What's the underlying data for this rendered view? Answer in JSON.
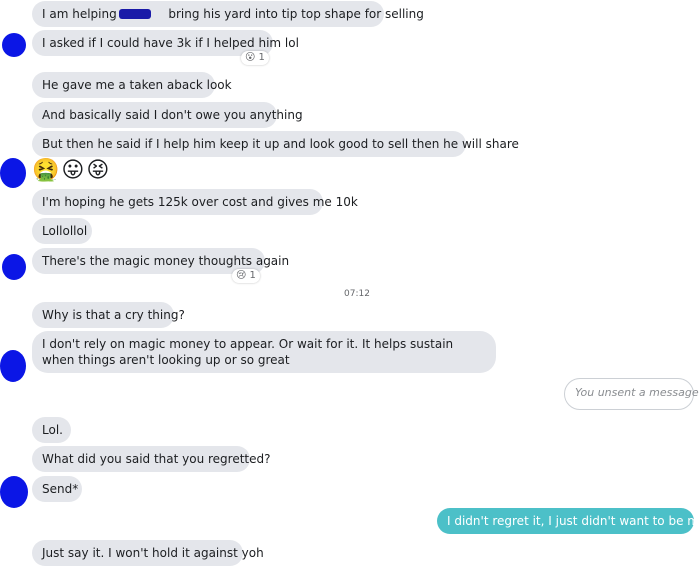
{
  "colors": {
    "incoming_bubble": "#e4e6eb",
    "outgoing_bubble": "#4cc0c8",
    "redaction": "#0b16e6"
  },
  "messages": [
    {
      "text": "I am helping"
    },
    {
      "text": "bring his yard into tip top shape for selling"
    },
    {
      "text": "I asked if I could have 3k if I helped him lol",
      "reaction": {
        "emoji": "😮",
        "count": "1"
      }
    },
    {
      "text": "He gave me a taken aback look"
    },
    {
      "text": "And basically said I don't owe you anything"
    },
    {
      "text": "But then he said if I help him keep it up and look good to sell then he will share"
    },
    {
      "emojis": "🤮😛😝"
    },
    {
      "text": "I'm hoping he gets 125k over cost and gives me 10k"
    },
    {
      "text": "Lollollol"
    },
    {
      "text": "There's the magic money thoughts again",
      "reaction": {
        "emoji": "😢",
        "count": "1"
      }
    },
    {
      "timestamp": "07:12"
    },
    {
      "text": "Why is that a cry thing?"
    },
    {
      "text": "I don't rely on magic money to appear. Or wait for it. It helps sustain when things aren't looking up or so great"
    },
    {
      "unsent": "You unsent a message"
    },
    {
      "text": "Lol."
    },
    {
      "text": "What did you said that you regretted?"
    },
    {
      "text": "Send*"
    },
    {
      "outgoing": "I didn't regret it, I just didn't want to be mean."
    },
    {
      "text": "Just say it. I won't hold it against yoh"
    }
  ]
}
